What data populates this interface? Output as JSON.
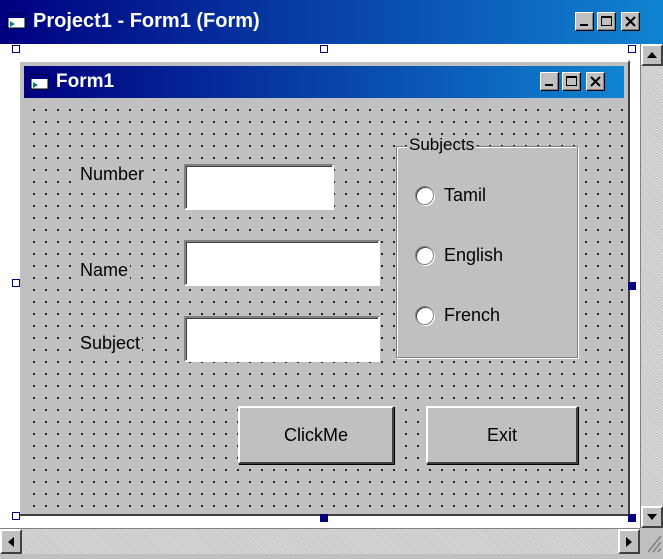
{
  "designer": {
    "title": "Project1 - Form1 (Form)",
    "icon": "form-window-icon"
  },
  "form": {
    "title": "Form1",
    "icon": "form-window-icon",
    "fields": {
      "number_label": "Number",
      "name_label": "Name",
      "subject_label": "Subject",
      "number_value": "",
      "name_value": "",
      "subject_value": ""
    },
    "subjects": {
      "caption": "Subjects",
      "options": [
        "Tamil",
        "English",
        "French"
      ]
    },
    "buttons": {
      "clickme": "ClickMe",
      "exit": "Exit"
    }
  },
  "caption_buttons": {
    "minimize": "minimize-icon",
    "maximize": "maximize-icon",
    "close": "close-icon"
  },
  "colors": {
    "titlebar_start": "#000080",
    "titlebar_end": "#1084d0",
    "face": "#c0c0c0",
    "selection_handle": "#000080"
  }
}
